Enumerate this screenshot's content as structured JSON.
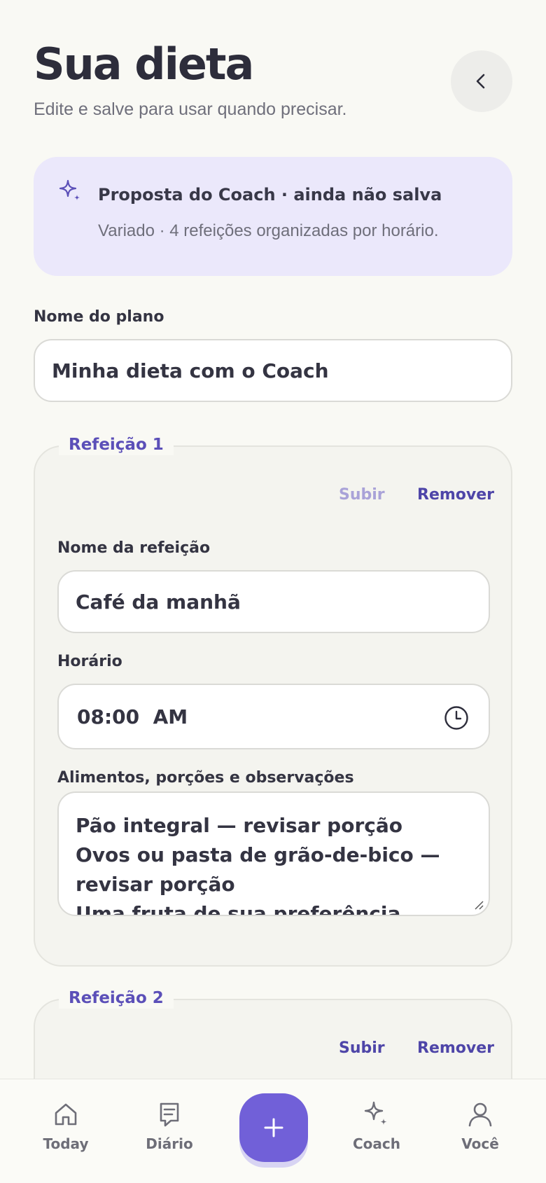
{
  "header": {
    "title": "Sua dieta",
    "subtitle": "Edite e salve para usar quando precisar.",
    "back_icon": "chevron-left-icon"
  },
  "coach_card": {
    "icon": "sparkle-icon",
    "title": "Proposta do Coach · ainda não salva",
    "description": "Variado · 4 refeições organizadas por horário.",
    "background": "#ebe8fb"
  },
  "plan": {
    "name_label": "Nome do plano",
    "name_value": "Minha dieta com o Coach"
  },
  "meals": [
    {
      "legend": "Refeição 1",
      "up_label": "Subir",
      "remove_label": "Remover",
      "name_label": "Nome da refeição",
      "name_value": "Café da manhã",
      "time_label": "Horário",
      "time_value": "08:00  AM",
      "foods_label": "Alimentos, porções e observações",
      "foods_value": "Pão integral — revisar porção\nOvos ou pasta de grão-de-bico — revisar porção\nUma fruta de sua preferência"
    },
    {
      "legend": "Refeição 2",
      "up_label": "Subir",
      "remove_label": "Remover"
    }
  ],
  "nav": {
    "items": [
      {
        "label": "Today",
        "icon": "home-icon"
      },
      {
        "label": "Diário",
        "icon": "journal-icon"
      },
      {
        "label": "Coach",
        "icon": "sparkle-icon"
      },
      {
        "label": "Você",
        "icon": "user-icon"
      }
    ],
    "fab_icon": "plus-icon"
  },
  "colors": {
    "accent": "#7160d8",
    "accent_text": "#4e45a8",
    "background": "#f9f9f4"
  }
}
